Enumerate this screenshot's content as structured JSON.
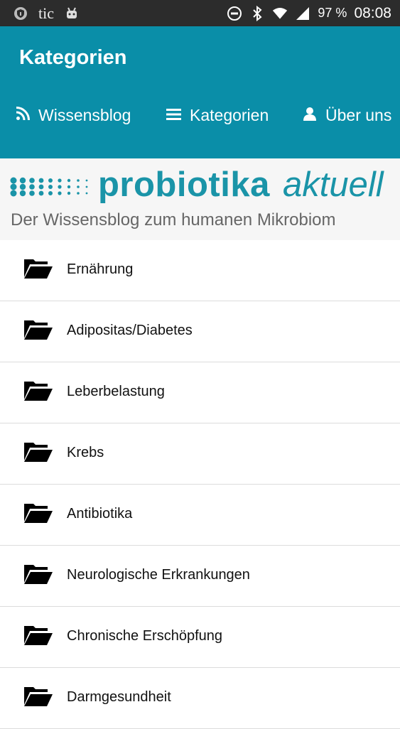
{
  "status_bar": {
    "carrier_text": "tic",
    "battery": "97 %",
    "time": "08:08",
    "icons": [
      "shield-icon",
      "android-icon",
      "dnd-icon",
      "bluetooth-icon",
      "wifi-icon",
      "signal-icon"
    ]
  },
  "app_bar": {
    "title": "Kategorien",
    "nav": [
      {
        "label": "Wissensblog",
        "icon": "rss-icon"
      },
      {
        "label": "Kategorien",
        "icon": "menu-icon"
      },
      {
        "label": "Über uns",
        "icon": "user-icon"
      }
    ]
  },
  "banner": {
    "logo_main": "probiotika",
    "logo_sub": "aktuell",
    "tagline": "Der Wissensblog zum humanen Mikrobiom"
  },
  "categories": [
    {
      "label": "Ernährung"
    },
    {
      "label": "Adipositas/Diabetes"
    },
    {
      "label": "Leberbelastung"
    },
    {
      "label": "Krebs"
    },
    {
      "label": "Antibiotika"
    },
    {
      "label": "Neurologische Erkrankungen"
    },
    {
      "label": "Chronische Erschöpfung"
    },
    {
      "label": "Darmgesundheit"
    }
  ],
  "colors": {
    "primary": "#0a8ea8",
    "logo": "#1a94a8",
    "status_bar": "#2c2c2c"
  }
}
